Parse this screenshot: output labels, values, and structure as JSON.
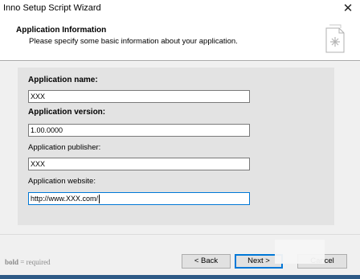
{
  "window": {
    "title": "Inno Setup Script Wizard",
    "close_glyph": "✕"
  },
  "header": {
    "title": "Application Information",
    "subtitle": "Please specify some basic information about your application.",
    "icon": "wizard-document-icon"
  },
  "form": {
    "name": {
      "label": "Application name:",
      "value": "XXX",
      "required": true
    },
    "version": {
      "label": "Application version:",
      "value": "1.00.0000",
      "required": true
    },
    "publisher": {
      "label": "Application publisher:",
      "value": "XXX",
      "required": false
    },
    "website": {
      "label": "Application website:",
      "value": "http://www.XXX.com/",
      "required": false
    }
  },
  "footer": {
    "legend_bold": "bold",
    "legend_rest": " = required",
    "back_label": "< Back",
    "next_label": "Next >",
    "cancel_label": "Cancel"
  },
  "colors": {
    "panel_bg": "#f0f0f0",
    "form_bg": "#e3e3e3",
    "focus_border": "#0078d7",
    "taskbar": "#2e5a86"
  }
}
